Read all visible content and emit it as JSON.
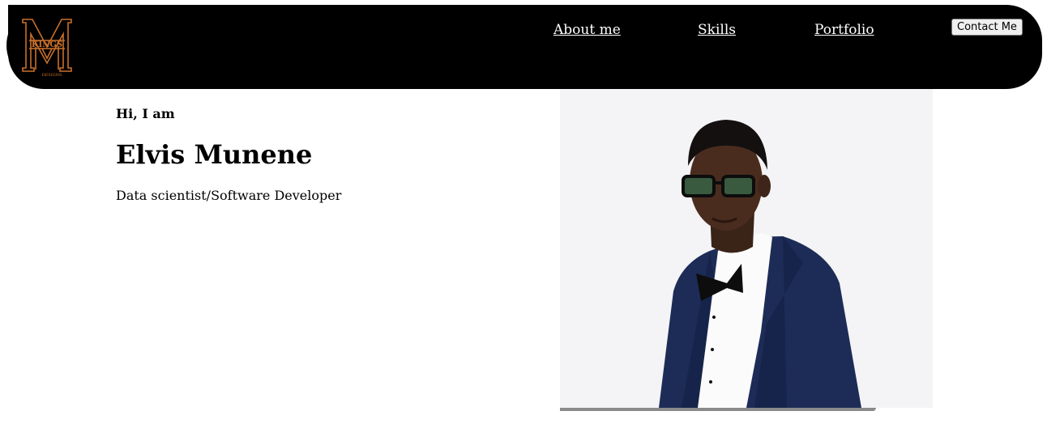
{
  "logo": {
    "icon": "kings-designs-logo",
    "text_top": "KINGS",
    "text_bottom": "DESIGNS",
    "accent": "#c9702a",
    "background": "#000000"
  },
  "nav": {
    "links": [
      {
        "label": "About me"
      },
      {
        "label": "Skills"
      },
      {
        "label": "Portfolio"
      }
    ],
    "contact_label": "Contact Me",
    "background": "#000000"
  },
  "hero": {
    "greeting": "Hi, I am",
    "name": "Elvis Munene",
    "role": "Data scientist/Software Developer"
  },
  "photo": {
    "icon": "portrait-photo",
    "suit_color": "#1d2c57",
    "background": "#f4f4f6"
  }
}
